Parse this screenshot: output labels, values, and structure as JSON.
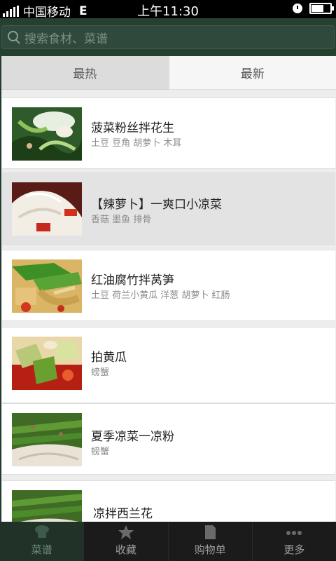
{
  "status_bar": {
    "carrier": "中国移动",
    "network": "E",
    "time": "上午11:30"
  },
  "search": {
    "placeholder": "搜索食材、菜谱"
  },
  "tabs": [
    {
      "label": "最热"
    },
    {
      "label": "最新"
    }
  ],
  "recipes": [
    {
      "title": "菠菜粉丝拌花生",
      "tags": "土豆  豆角  胡萝卜  木耳"
    },
    {
      "title": "【辣萝卜】一爽口小凉菜",
      "tags": "香菇  墨鱼  排骨"
    },
    {
      "title": "红油腐竹拌莴笋",
      "tags": "土豆  荷兰小黄瓜  洋葱  胡萝卜  红肠"
    },
    {
      "title": "拍黄瓜",
      "tags": "螃蟹"
    },
    {
      "title": "夏季凉菜一凉粉",
      "tags": "螃蟹"
    },
    {
      "title": "凉拌西兰花",
      "tags": ""
    }
  ],
  "bottom_nav": [
    {
      "label": "菜谱",
      "icon": "chef-hat-icon"
    },
    {
      "label": "收藏",
      "icon": "star-icon"
    },
    {
      "label": "购物单",
      "icon": "document-icon"
    },
    {
      "label": "更多",
      "icon": "more-dots-icon"
    }
  ],
  "colors": {
    "header": "#25402f",
    "bottom_bar": "#1b1b1b",
    "active_nav": "#213329"
  }
}
